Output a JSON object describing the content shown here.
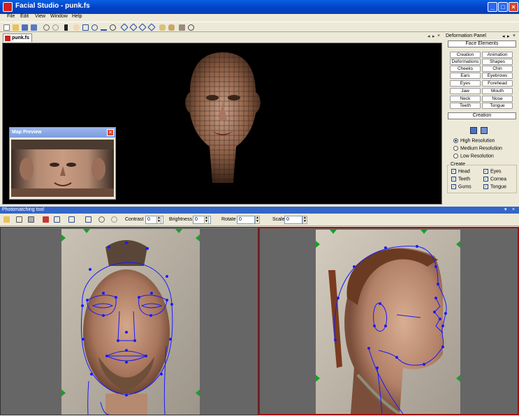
{
  "window": {
    "title": "Facial Studio - punk.fs",
    "minimize": "_",
    "maximize": "□",
    "close": "×"
  },
  "menu": [
    "File",
    "Edit",
    "View",
    "Window",
    "Help"
  ],
  "document_tab": {
    "label": "punk.fs"
  },
  "viewport_controls": [
    "◂",
    "▸",
    "×"
  ],
  "map_preview": {
    "title": "Map Preview",
    "close": "×"
  },
  "deformation_panel": {
    "title": "Deformation Panel",
    "controls": [
      "◂",
      "▸",
      "×"
    ],
    "face_elements_header": "Face Elements",
    "face_elements": [
      [
        "Creation",
        "Animation"
      ],
      [
        "Deformations",
        "Shapes"
      ],
      [
        "Cheeks",
        "Chin"
      ],
      [
        "Ears",
        "Eyebrows"
      ],
      [
        "Eyes",
        "Forehead"
      ],
      [
        "Jaw",
        "Mouth"
      ],
      [
        "Neck",
        "Nose"
      ],
      [
        "Teeth",
        "Tongue"
      ]
    ],
    "creation_header": "Creation",
    "resolution_options": [
      {
        "label": "High Resolution",
        "selected": true
      },
      {
        "label": "Medium Resolution",
        "selected": false
      },
      {
        "label": "Low Resolution",
        "selected": false
      }
    ],
    "create_group_label": "Create",
    "create_items": [
      {
        "label": "Head",
        "checked": true
      },
      {
        "label": "Eyes",
        "checked": true
      },
      {
        "label": "Teeth",
        "checked": true
      },
      {
        "label": "Cornea",
        "checked": true
      },
      {
        "label": "Gums",
        "checked": true
      },
      {
        "label": "Tongue",
        "checked": true
      }
    ]
  },
  "photomatching": {
    "title": "Photomatching tool",
    "controls": [
      "▾",
      "×"
    ],
    "contrast_label": "Contrast",
    "contrast_value": "0",
    "brightness_label": "Brightness",
    "brightness_value": "0",
    "rotate_label": "Rotate",
    "rotate_value": "0",
    "scale_label": "Scale",
    "scale_value": "0"
  },
  "colors": {
    "titlebar": "#0a5fe3",
    "chrome": "#ece9d8",
    "spline": "#1a1aff",
    "active_pane_border": "#a01010",
    "marker_green": "#1a9e2a"
  }
}
